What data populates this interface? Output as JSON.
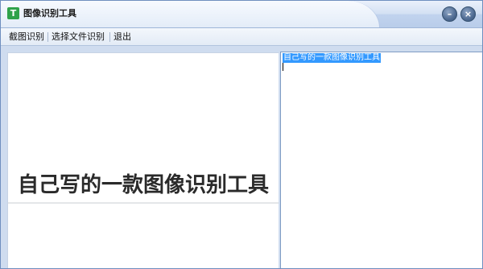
{
  "window": {
    "title": "图像识别工具",
    "icon_glyph": "T",
    "icon": "app-t-icon",
    "minimize_glyph": "–",
    "close_glyph": "×"
  },
  "menu": {
    "items": [
      {
        "label": "截图识别"
      },
      {
        "label": "选择文件识别"
      },
      {
        "label": "退出"
      }
    ]
  },
  "left_pane": {
    "captured_image_text": "自己写的一款图像识别工具"
  },
  "right_pane": {
    "recognized_text": "自己写的一款图像识别工具"
  },
  "colors": {
    "selection": "#3399ff",
    "app_icon": "#2fa24a",
    "border": "#7f9cc4"
  }
}
